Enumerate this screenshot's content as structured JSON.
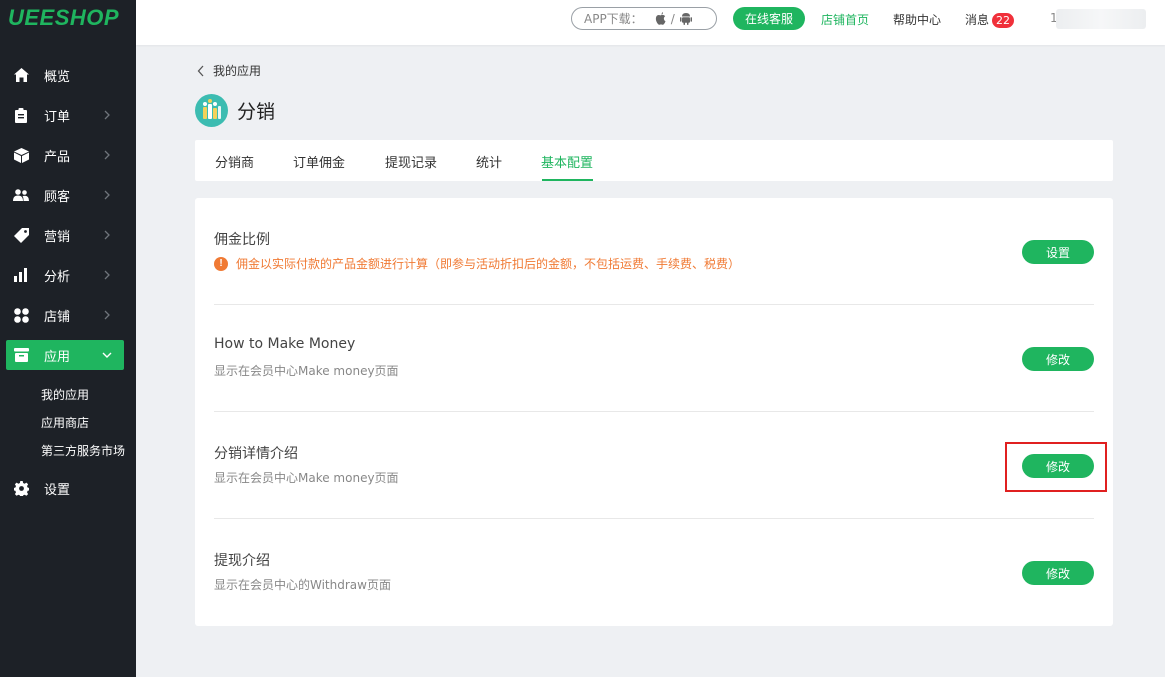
{
  "brand": {
    "logo": "UEESHOP"
  },
  "sidebar": {
    "items": [
      {
        "label": "概览",
        "icon": "home-icon"
      },
      {
        "label": "订单",
        "icon": "clipboard-icon"
      },
      {
        "label": "产品",
        "icon": "box-icon"
      },
      {
        "label": "顾客",
        "icon": "users-icon"
      },
      {
        "label": "营销",
        "icon": "tag-icon"
      },
      {
        "label": "分析",
        "icon": "bar-chart-icon"
      },
      {
        "label": "店铺",
        "icon": "grid-icon"
      },
      {
        "label": "应用",
        "icon": "app-store-icon"
      },
      {
        "label": "设置",
        "icon": "gear-icon"
      }
    ],
    "sub_items": [
      "我的应用",
      "应用商店",
      "第三方服务市场"
    ]
  },
  "topbar": {
    "app_download": "APP下载：",
    "app_sep": "/",
    "online_service": "在线客服",
    "store_home": "店铺首页",
    "help_center": "帮助中心",
    "messages": "消息",
    "message_count": "22",
    "user_prefix": "1"
  },
  "breadcrumb": {
    "back_label": "我的应用"
  },
  "app": {
    "title": "分销"
  },
  "tabs": [
    "分销商",
    "订单佣金",
    "提现记录",
    "统计",
    "基本配置"
  ],
  "settings": [
    {
      "title": "佣金比例",
      "desc": "佣金以实际付款的产品金额进行计算（即参与活动折扣后的金额，不包括运费、手续费、税费）",
      "button": "设置"
    },
    {
      "title": "How to Make Money",
      "desc": "显示在会员中心Make money页面",
      "button": "修改"
    },
    {
      "title": "分销详情介绍",
      "desc": "显示在会员中心Make money页面",
      "button": "修改"
    },
    {
      "title": "提现介绍",
      "desc": "显示在会员中心的Withdraw页面",
      "button": "修改"
    }
  ],
  "colors": {
    "accent": "#1fb55f",
    "sidebar_bg": "#1d2127",
    "warning": "#f07a34",
    "highlight": "#e02020"
  }
}
